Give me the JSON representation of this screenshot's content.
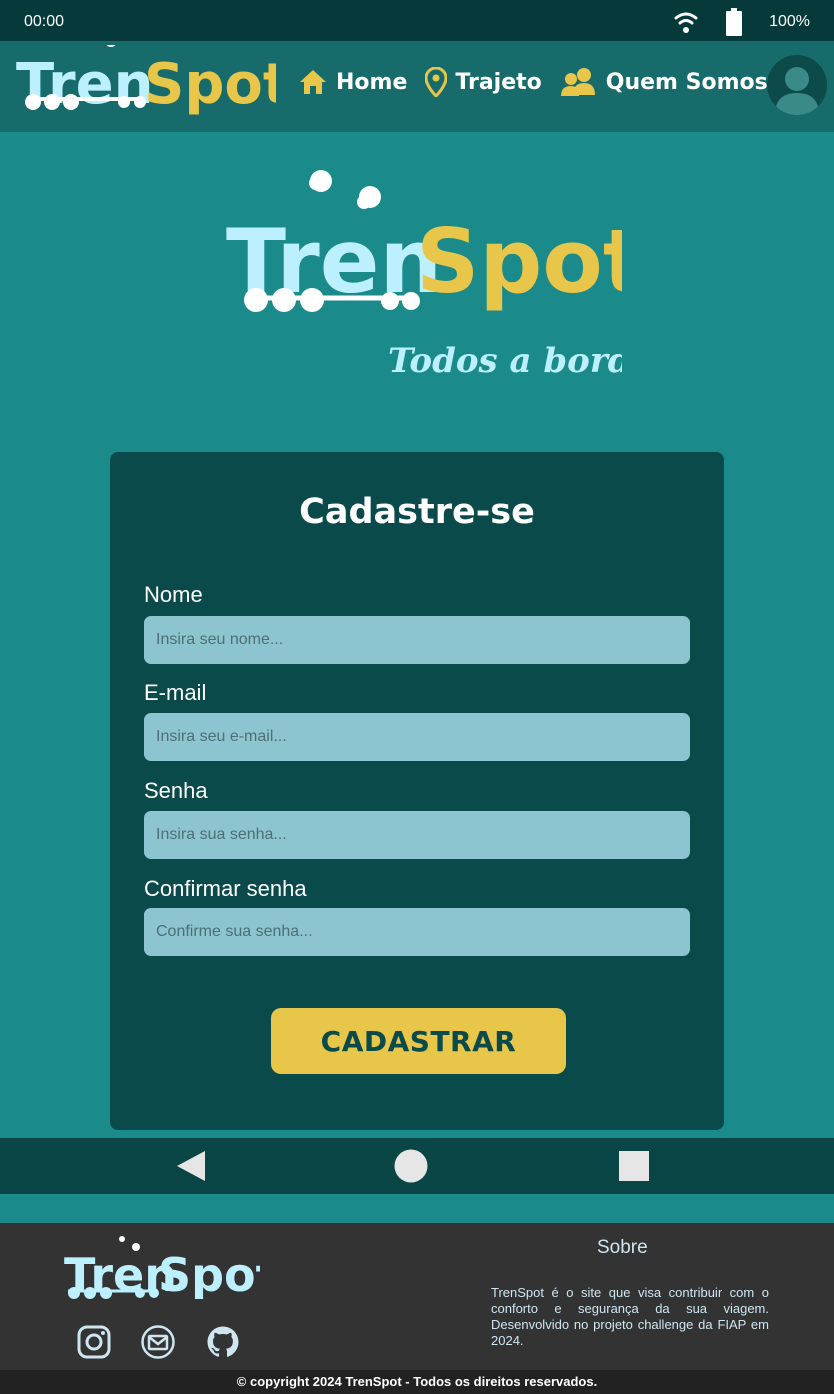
{
  "status_bar": {
    "time": "00:00",
    "battery": "100%"
  },
  "brand": {
    "part1": "Tren",
    "part2": "Spot",
    "tagline": "Todos a bordo!"
  },
  "nav": {
    "items": [
      {
        "label": "Home",
        "icon": "home-icon"
      },
      {
        "label": "Trajeto",
        "icon": "map-pin-icon"
      },
      {
        "label": "Quem Somos",
        "icon": "users-icon"
      }
    ]
  },
  "form": {
    "title": "Cadastre-se",
    "fields": [
      {
        "label": "Nome",
        "placeholder": "Insira seu nome...",
        "value": ""
      },
      {
        "label": "E-mail",
        "placeholder": "Insira seu e-mail...",
        "value": ""
      },
      {
        "label": "Senha",
        "placeholder": "Insira sua senha...",
        "value": ""
      },
      {
        "label": "Confirmar senha",
        "placeholder": "Confirme sua senha...",
        "value": ""
      }
    ],
    "submit_label": "CADASTRAR"
  },
  "footer": {
    "sobre_title": "Sobre",
    "sobre_text": "TrenSpot é o site que visa contribuir com o conforto e segurança da sua viagem. Desenvolvido no projeto challenge da FIAP em 2024.",
    "social": [
      "instagram-icon",
      "mail-icon",
      "github-icon"
    ],
    "copyright": "© copyright 2024 TrenSpot - Todos os direitos reservados."
  },
  "colors": {
    "background": "#1a8a8a",
    "header": "#176b6b",
    "card": "#0a4a4a",
    "accent_yellow": "#e8c64a",
    "accent_light_blue": "#bdf0ff",
    "input": "#8cc5d0",
    "footer": "#333333"
  }
}
